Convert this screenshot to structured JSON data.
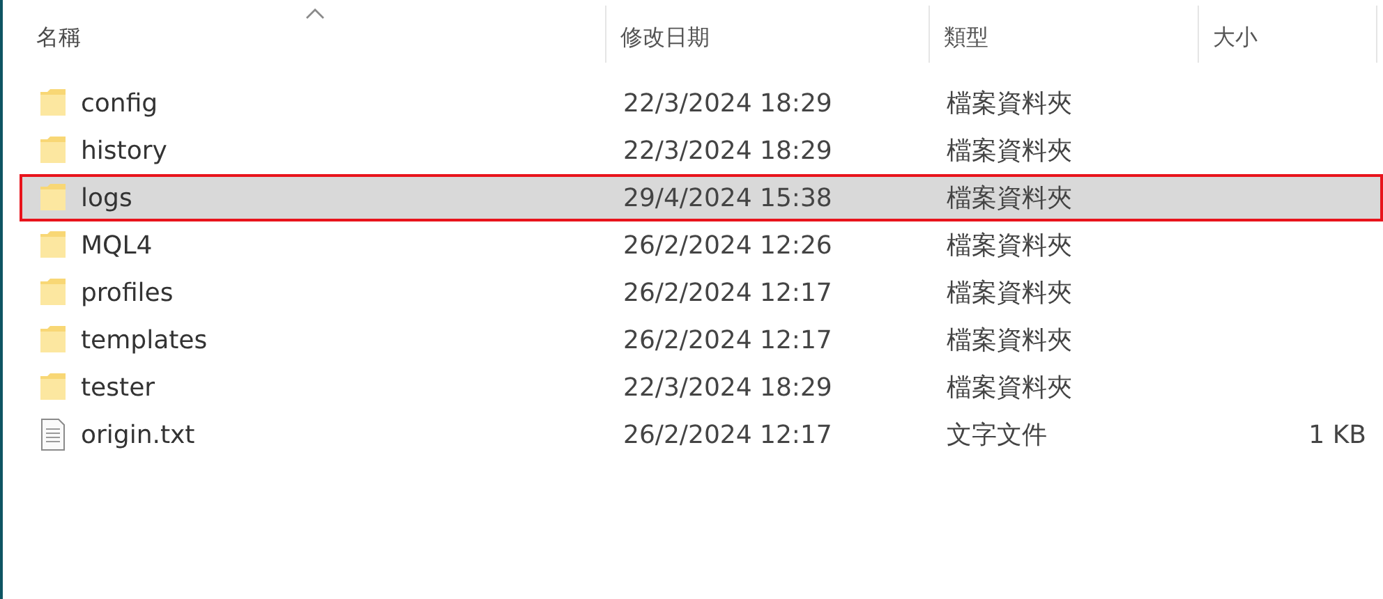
{
  "columns": [
    {
      "label": "名稱",
      "sorted": true
    },
    {
      "label": "修改日期",
      "sorted": false
    },
    {
      "label": "類型",
      "sorted": false
    },
    {
      "label": "大小",
      "sorted": false
    }
  ],
  "rows": [
    {
      "kind": "folder",
      "name": "config",
      "modified": "22/3/2024 18:29",
      "type": "檔案資料夾",
      "selected": false,
      "outlined": false
    },
    {
      "kind": "folder",
      "name": "history",
      "modified": "22/3/2024 18:29",
      "type": "檔案資料夾",
      "selected": false,
      "outlined": false
    },
    {
      "kind": "folder",
      "name": "logs",
      "modified": "29/4/2024 15:38",
      "type": "檔案資料夾",
      "selected": true,
      "outlined": true
    },
    {
      "kind": "folder",
      "name": "MQL4",
      "modified": "26/2/2024 12:26",
      "type": "檔案資料夾",
      "selected": false,
      "outlined": false
    },
    {
      "kind": "folder",
      "name": "profiles",
      "modified": "26/2/2024 12:17",
      "type": "檔案資料夾",
      "selected": false,
      "outlined": false
    },
    {
      "kind": "folder",
      "name": "templates",
      "modified": "26/2/2024 12:17",
      "type": "檔案資料夾",
      "selected": false,
      "outlined": false
    },
    {
      "kind": "folder",
      "name": "tester",
      "modified": "22/3/2024 18:29",
      "type": "檔案資料夾",
      "selected": false,
      "outlined": false
    },
    {
      "kind": "file",
      "name": "origin.txt",
      "modified": "26/2/2024 12:17",
      "type": "文字文件",
      "size": "1 KB",
      "selected": false,
      "outlined": false
    }
  ]
}
